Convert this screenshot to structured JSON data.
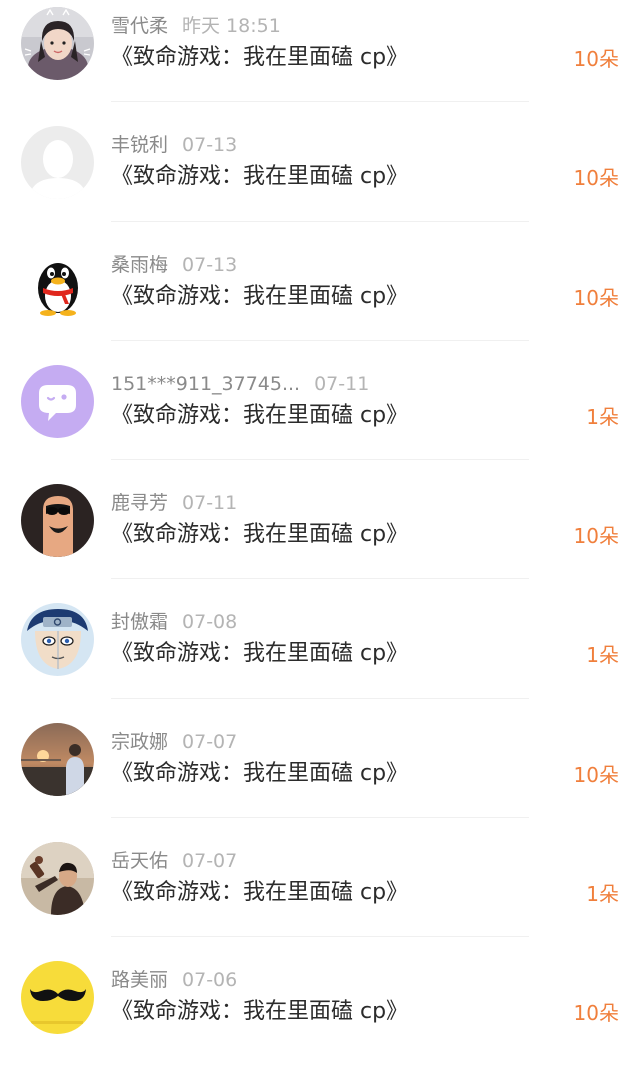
{
  "accent_color": "#f07f3c",
  "gift_list": [
    {
      "name": "雪代柔",
      "date": "昨天 18:51",
      "title": "《致命游戏：我在里面磕 cp》",
      "amount": "10朵",
      "avatar_icon": "girl-selfie-avatar"
    },
    {
      "name": "丰锐利",
      "date": "07-13",
      "title": "《致命游戏：我在里面磕 cp》",
      "amount": "10朵",
      "avatar_icon": "default-user-avatar"
    },
    {
      "name": "桑雨梅",
      "date": "07-13",
      "title": "《致命游戏：我在里面磕 cp》",
      "amount": "10朵",
      "avatar_icon": "qq-penguin-avatar"
    },
    {
      "name": "151***911_37745...",
      "date": "07-11",
      "title": "《致命游戏：我在里面磕 cp》",
      "amount": "1朵",
      "avatar_icon": "chat-bubble-avatar"
    },
    {
      "name": "鹿寻芳",
      "date": "07-11",
      "title": "《致命游戏：我在里面磕 cp》",
      "amount": "10朵",
      "avatar_icon": "finger-face-avatar"
    },
    {
      "name": "封傲霜",
      "date": "07-08",
      "title": "《致命游戏：我在里面磕 cp》",
      "amount": "1朵",
      "avatar_icon": "anime-ninja-avatar"
    },
    {
      "name": "宗政娜",
      "date": "07-07",
      "title": "《致命游戏：我在里面磕 cp》",
      "amount": "10朵",
      "avatar_icon": "sunset-photo-avatar"
    },
    {
      "name": "岳天佑",
      "date": "07-07",
      "title": "《致命游戏：我在里面磕 cp》",
      "amount": "1朵",
      "avatar_icon": "man-drinking-avatar"
    },
    {
      "name": "路美丽",
      "date": "07-06",
      "title": "《致命游戏：我在里面磕 cp》",
      "amount": "10朵",
      "avatar_icon": "mustache-avatar"
    }
  ]
}
